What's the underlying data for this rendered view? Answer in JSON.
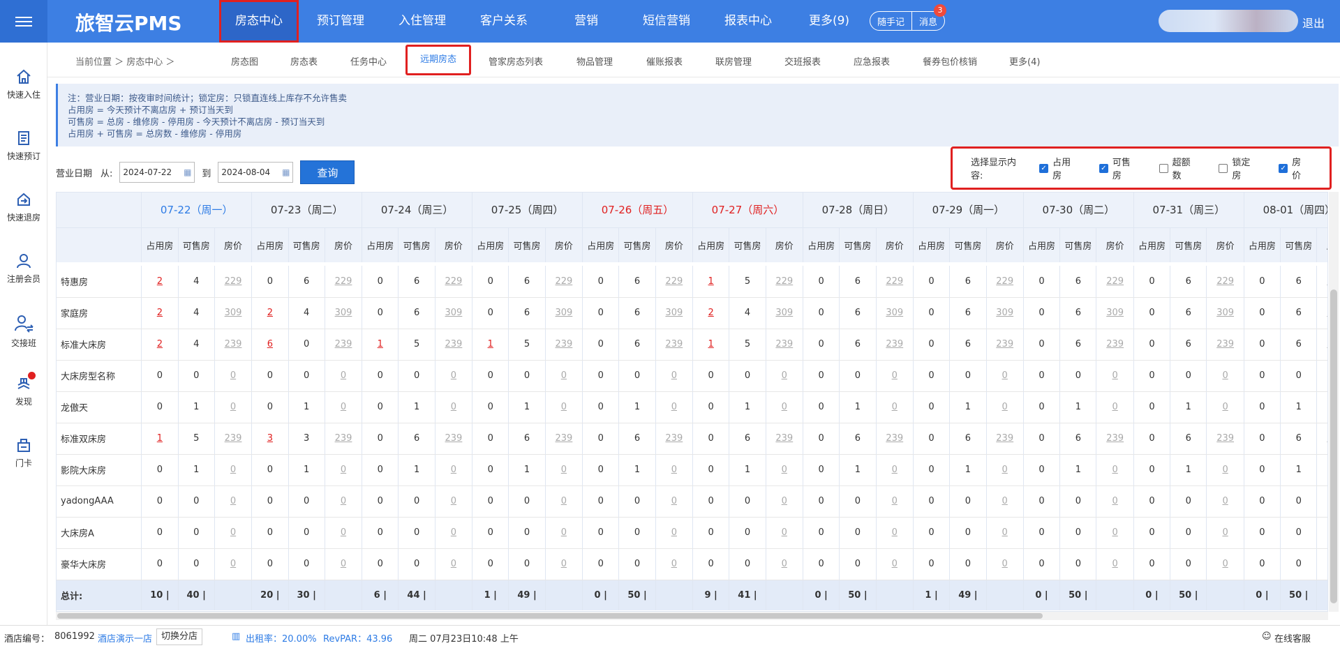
{
  "app": {
    "logo": "旅智云PMS",
    "logout": "退出"
  },
  "topnav": [
    "房态中心",
    "预订管理",
    "入住管理",
    "客户关系",
    "营销",
    "短信营销",
    "报表中心",
    "更多(9)"
  ],
  "pill": {
    "memo": "随手记",
    "msg": "消息",
    "msg_count": "3"
  },
  "sidebar": [
    {
      "label": "快速入住",
      "icon": "home-icon"
    },
    {
      "label": "快速预订",
      "icon": "document-icon"
    },
    {
      "label": "快速退房",
      "icon": "checkout-icon"
    },
    {
      "label": "注册会员",
      "icon": "user-icon"
    },
    {
      "label": "交接班",
      "icon": "handover-icon"
    },
    {
      "label": "发现",
      "icon": "discover-icon"
    },
    {
      "label": "门卡",
      "icon": "card-icon"
    }
  ],
  "breadcrumb": "当前位置 ＞ 房态中心 ＞",
  "subtabs": [
    "房态图",
    "房态表",
    "任务中心",
    "远期房态",
    "管家房态列表",
    "物品管理",
    "催账报表",
    "联房管理",
    "交班报表",
    "应急报表",
    "餐券包价核销",
    "更多(4)"
  ],
  "notes": [
    "注：营业日期：按夜审时间统计；锁定房：只锁直连线上库存不允许售卖",
    "占用房 = 今天预计不离店房 + 预订当天到",
    "可售房 = 总房 - 维修房 - 停用房 - 今天预计不离店房 - 预订当天到",
    "占用房 + 可售房 = 总房数 - 维修房 - 停用房"
  ],
  "filter": {
    "label": "营业日期",
    "from": "从:",
    "from_date": "2024-07-22",
    "to": "到",
    "to_date": "2024-08-04",
    "query": "查询"
  },
  "display_options": {
    "label": "选择显示内容:",
    "items": [
      {
        "label": "占用房",
        "checked": true
      },
      {
        "label": "可售房",
        "checked": true
      },
      {
        "label": "超额数",
        "checked": false
      },
      {
        "label": "锁定房",
        "checked": false
      },
      {
        "label": "房价",
        "checked": true
      }
    ]
  },
  "table": {
    "dates": [
      {
        "label": "07-22（周一）",
        "color": "blue"
      },
      {
        "label": "07-23（周二）",
        "color": "normal"
      },
      {
        "label": "07-24（周三）",
        "color": "normal"
      },
      {
        "label": "07-25（周四）",
        "color": "normal"
      },
      {
        "label": "07-26（周五）",
        "color": "red"
      },
      {
        "label": "07-27（周六）",
        "color": "red"
      },
      {
        "label": "07-28（周日）",
        "color": "normal"
      },
      {
        "label": "07-29（周一）",
        "color": "normal"
      },
      {
        "label": "07-30（周二）",
        "color": "normal"
      },
      {
        "label": "07-31（周三）",
        "color": "normal"
      },
      {
        "label": "08-01（周四）",
        "color": "normal"
      }
    ],
    "sub_headers": [
      "占用房",
      "可售房",
      "房价"
    ],
    "rows": [
      {
        "name": "特惠房",
        "price": "229",
        "cells": [
          [
            2,
            4
          ],
          [
            0,
            6
          ],
          [
            0,
            6
          ],
          [
            0,
            6
          ],
          [
            0,
            6
          ],
          [
            1,
            5
          ],
          [
            0,
            6
          ],
          [
            0,
            6
          ],
          [
            0,
            6
          ],
          [
            0,
            6
          ],
          [
            0,
            6
          ]
        ]
      },
      {
        "name": "家庭房",
        "price": "309",
        "cells": [
          [
            2,
            4
          ],
          [
            2,
            4
          ],
          [
            0,
            6
          ],
          [
            0,
            6
          ],
          [
            0,
            6
          ],
          [
            2,
            4
          ],
          [
            0,
            6
          ],
          [
            0,
            6
          ],
          [
            0,
            6
          ],
          [
            0,
            6
          ],
          [
            0,
            6
          ]
        ]
      },
      {
        "name": "标准大床房",
        "price": "239",
        "cells": [
          [
            2,
            4
          ],
          [
            6,
            0
          ],
          [
            1,
            5
          ],
          [
            1,
            5
          ],
          [
            0,
            6
          ],
          [
            1,
            5
          ],
          [
            0,
            6
          ],
          [
            0,
            6
          ],
          [
            0,
            6
          ],
          [
            0,
            6
          ],
          [
            0,
            6
          ]
        ]
      },
      {
        "name": "大床房型名称",
        "price": "0",
        "cells": [
          [
            0,
            0
          ],
          [
            0,
            0
          ],
          [
            0,
            0
          ],
          [
            0,
            0
          ],
          [
            0,
            0
          ],
          [
            0,
            0
          ],
          [
            0,
            0
          ],
          [
            0,
            0
          ],
          [
            0,
            0
          ],
          [
            0,
            0
          ],
          [
            0,
            0
          ]
        ]
      },
      {
        "name": "龙傲天",
        "price": "0",
        "cells": [
          [
            0,
            1
          ],
          [
            0,
            1
          ],
          [
            0,
            1
          ],
          [
            0,
            1
          ],
          [
            0,
            1
          ],
          [
            0,
            1
          ],
          [
            0,
            1
          ],
          [
            0,
            1
          ],
          [
            0,
            1
          ],
          [
            0,
            1
          ],
          [
            0,
            1
          ]
        ]
      },
      {
        "name": "标准双床房",
        "price": "239",
        "cells": [
          [
            1,
            5
          ],
          [
            3,
            3
          ],
          [
            0,
            6
          ],
          [
            0,
            6
          ],
          [
            0,
            6
          ],
          [
            0,
            6
          ],
          [
            0,
            6
          ],
          [
            0,
            6
          ],
          [
            0,
            6
          ],
          [
            0,
            6
          ],
          [
            0,
            6
          ]
        ]
      },
      {
        "name": "影院大床房",
        "price": "0",
        "cells": [
          [
            0,
            1
          ],
          [
            0,
            1
          ],
          [
            0,
            1
          ],
          [
            0,
            1
          ],
          [
            0,
            1
          ],
          [
            0,
            1
          ],
          [
            0,
            1
          ],
          [
            0,
            1
          ],
          [
            0,
            1
          ],
          [
            0,
            1
          ],
          [
            0,
            1
          ]
        ]
      },
      {
        "name": "yadongAAA",
        "price": "0",
        "cells": [
          [
            0,
            0
          ],
          [
            0,
            0
          ],
          [
            0,
            0
          ],
          [
            0,
            0
          ],
          [
            0,
            0
          ],
          [
            0,
            0
          ],
          [
            0,
            0
          ],
          [
            0,
            0
          ],
          [
            0,
            0
          ],
          [
            0,
            0
          ],
          [
            0,
            0
          ]
        ]
      },
      {
        "name": "大床房A",
        "price": "0",
        "cells": [
          [
            0,
            0
          ],
          [
            0,
            0
          ],
          [
            0,
            0
          ],
          [
            0,
            0
          ],
          [
            0,
            0
          ],
          [
            0,
            0
          ],
          [
            0,
            0
          ],
          [
            0,
            0
          ],
          [
            0,
            0
          ],
          [
            0,
            0
          ],
          [
            0,
            0
          ]
        ]
      },
      {
        "name": "豪华大床房",
        "price": "0",
        "cells": [
          [
            0,
            0
          ],
          [
            0,
            0
          ],
          [
            0,
            0
          ],
          [
            0,
            0
          ],
          [
            0,
            0
          ],
          [
            0,
            0
          ],
          [
            0,
            0
          ],
          [
            0,
            0
          ],
          [
            0,
            0
          ],
          [
            0,
            0
          ],
          [
            0,
            0
          ]
        ]
      }
    ],
    "total_label": "总计:",
    "totals": [
      [
        10,
        40
      ],
      [
        20,
        30
      ],
      [
        6,
        44
      ],
      [
        1,
        49
      ],
      [
        0,
        50
      ],
      [
        9,
        41
      ],
      [
        0,
        50
      ],
      [
        1,
        49
      ],
      [
        0,
        50
      ],
      [
        0,
        50
      ],
      [
        0,
        50
      ]
    ],
    "truncated_price": "2"
  },
  "status": {
    "hotel_no_label": "酒店编号：",
    "hotel_no": "8061992",
    "hotel_name": "酒店演示一店",
    "switch": "切换分店",
    "occupancy": "出租率：20.00%",
    "revpar": "RevPAR：43.96",
    "datetime": "周二 07月23日10:48 上午",
    "service": "在线客服"
  }
}
